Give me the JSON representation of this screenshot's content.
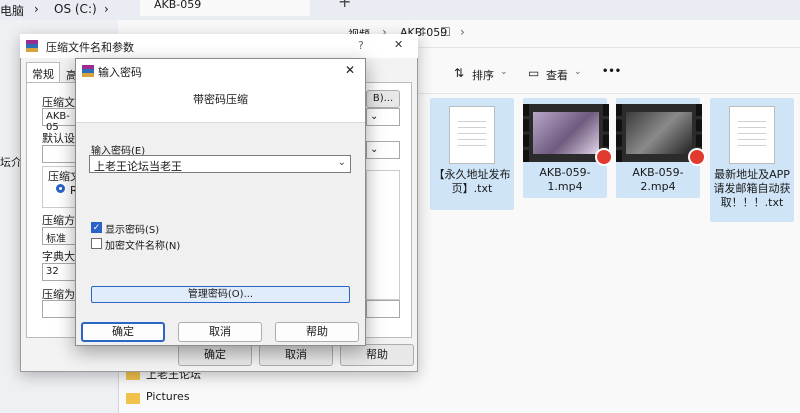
{
  "bg_explorer": {
    "breadcrumb_computer": "电脑",
    "breadcrumb_drive": "OS (C:)",
    "fragment_text": "坛介"
  },
  "explorer": {
    "tab_title": "AKB-059",
    "new_tab": "+",
    "path_part1": "视频",
    "path_part2": "AKB-059",
    "sort_label": "排序",
    "view_label": "查看",
    "more_label": "•••",
    "files": [
      {
        "name": "【永久地址发布页】.txt",
        "kind": "doc"
      },
      {
        "name": "AKB-059-1.mp4",
        "kind": "video"
      },
      {
        "name": "AKB-059-2.mp4",
        "kind": "video"
      },
      {
        "name": "最新地址及APP请发邮箱自动获取！！！.txt",
        "kind": "doc"
      }
    ],
    "nav_items": [
      "上老王论坛",
      "Pictures"
    ]
  },
  "params_dialog": {
    "title": "压缩文件名和参数",
    "help_glyph": "?",
    "close_glyph": "✕",
    "tab_general": "常规",
    "tab_advanced": "高",
    "archive_name_label": "压缩文",
    "archive_name_value": "AKB-05",
    "default_config_label": "默认设",
    "format_group_label": "压缩文",
    "format_option": "R",
    "method_label": "压缩方",
    "method_value": "标准",
    "dict_label": "字典大",
    "dict_value": "32",
    "split_label": "压缩为",
    "browse_suffix": "B)...",
    "ok": "确定",
    "cancel": "取消",
    "help": "帮助"
  },
  "pwd_dialog": {
    "title": "输入密码",
    "close_glyph": "✕",
    "heading": "带密码压缩",
    "password_label": "输入密码(E)",
    "password_value": "上老王论坛当老王",
    "show_password": "显示密码(S)",
    "show_password_checked": true,
    "encrypt_names": "加密文件名称(N)",
    "encrypt_names_checked": false,
    "manage_btn": "管理密码(O)...",
    "ok": "确定",
    "cancel": "取消",
    "help": "帮助"
  }
}
